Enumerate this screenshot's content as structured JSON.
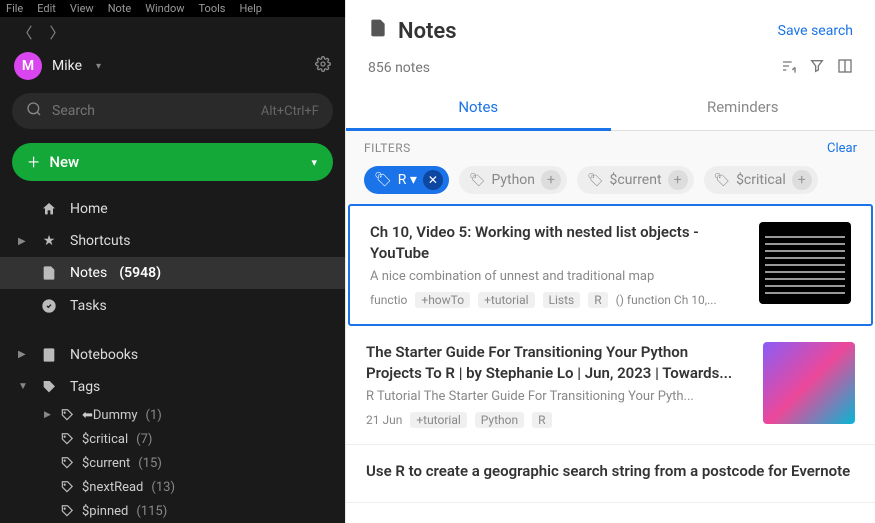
{
  "menubar": [
    "File",
    "Edit",
    "View",
    "Note",
    "Window",
    "Tools",
    "Help"
  ],
  "user": {
    "initial": "M",
    "name": "Mike"
  },
  "search": {
    "placeholder": "Search",
    "shortcut": "Alt+Ctrl+F"
  },
  "newBtn": "New",
  "nav": {
    "home": "Home",
    "shortcuts": "Shortcuts",
    "notes": "Notes",
    "notes_count": "(5948)",
    "tasks": "Tasks",
    "notebooks": "Notebooks",
    "tags": "Tags"
  },
  "tagTree": [
    {
      "name": "⬅Dummy",
      "count": "(1)"
    },
    {
      "name": "$critical",
      "count": "(7)"
    },
    {
      "name": "$current",
      "count": "(15)"
    },
    {
      "name": "$nextRead",
      "count": "(13)"
    },
    {
      "name": "$pinned",
      "count": "(115)"
    }
  ],
  "header": {
    "title": "Notes",
    "save": "Save search",
    "count": "856 notes"
  },
  "tabs": {
    "notes": "Notes",
    "reminders": "Reminders"
  },
  "filters": {
    "label": "FILTERS",
    "clear": "Clear",
    "active": {
      "label": "R"
    },
    "chips": [
      "Python",
      "$current",
      "$critical"
    ]
  },
  "notes": [
    {
      "title": "Ch 10, Video 5: Working with nested list objects - YouTube",
      "snippet": "A nice combination of unnest and traditional map",
      "meta": [
        "functio",
        "+howTo",
        "+tutorial",
        "Lists",
        "R",
        "() function Ch 10,..."
      ],
      "thumb": "code"
    },
    {
      "title": "The Starter Guide For Transitioning Your Python Projects To R | by Stephanie Lo | Jun, 2023 | Towards...",
      "snippet": "R Tutorial The Starter Guide For Transitioning Your Pyth...",
      "meta": [
        "21 Jun",
        "+tutorial",
        "Python",
        "R"
      ],
      "thumb": "art"
    },
    {
      "title": "Use R to create a geographic search string from a postcode for Evernote",
      "snippet": "",
      "meta": [],
      "thumb": ""
    }
  ]
}
